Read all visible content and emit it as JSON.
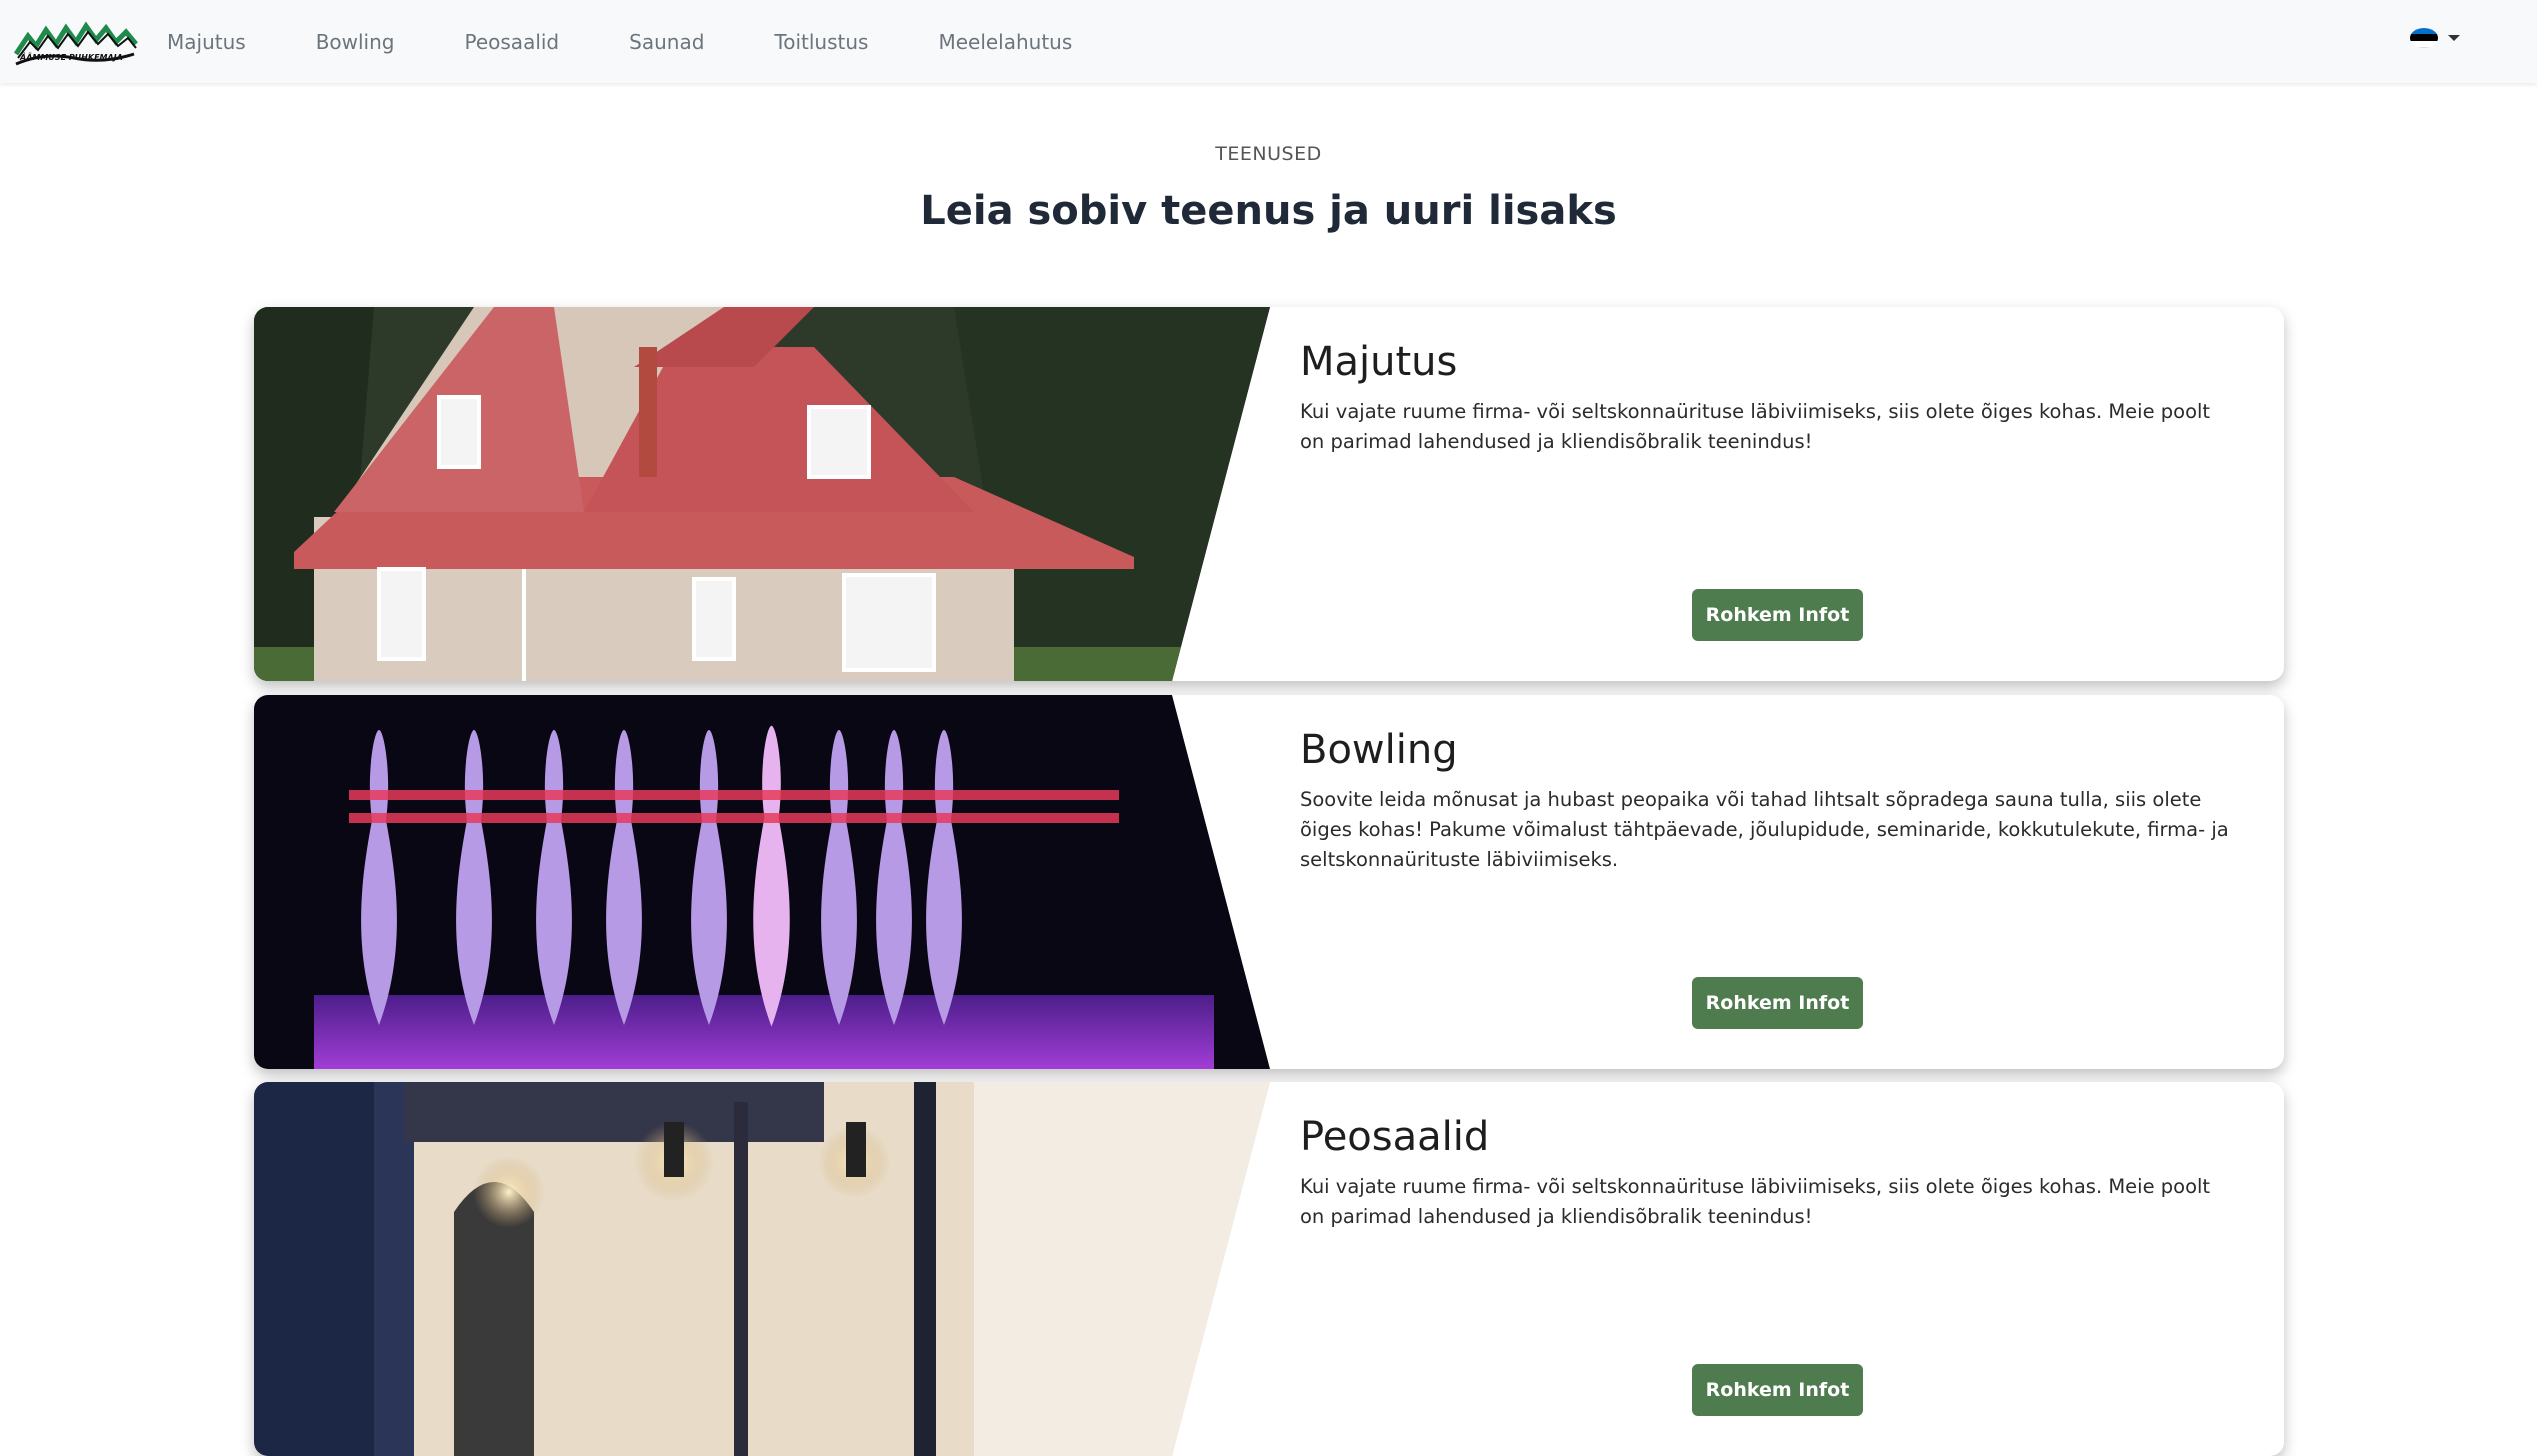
{
  "nav": {
    "items": [
      "Majutus",
      "Bowling",
      "Peosaalid",
      "Saunad",
      "Toitlustus",
      "Meelelahutus"
    ],
    "language": "Eesti",
    "flag_colors": [
      "#0072ce",
      "#000000",
      "#ffffff"
    ]
  },
  "header": {
    "label": "TEENUSED",
    "title": "Leia sobiv teenus ja uuri lisaks"
  },
  "cards": [
    {
      "title": "Majutus",
      "text": "Kui vajate ruume firma- või seltskonnaürituse läbiviimiseks, siis olete õiges kohas. Meie poolt on parimad lahendused ja kliendisõbralik teenindus!",
      "button": "Rohkem Infot",
      "image": "house-photo"
    },
    {
      "title": "Bowling",
      "text": "Soovite leida mõnusat ja hubast peopaika või tahad lihtsalt sõpradega sauna tulla, siis olete õiges kohas! Pakume võimalust tähtpäevade, jõulupidude, seminaride, kokkutulekute, firma- ja seltskonnaürituste läbiviimiseks.",
      "button": "Rohkem Infot",
      "image": "bowling-pins-photo"
    },
    {
      "title": "Peosaalid",
      "text": "Kui vajate ruume firma- või seltskonnaürituse läbiviimiseks, siis olete õiges kohas. Meie poolt on parimad lahendused ja kliendisõbralik teenindus!",
      "button": "Rohkem Infot",
      "image": "party-hall-photo"
    }
  ],
  "colors": {
    "button": "#4f7c4e",
    "navbar": "#f8f9fa"
  }
}
